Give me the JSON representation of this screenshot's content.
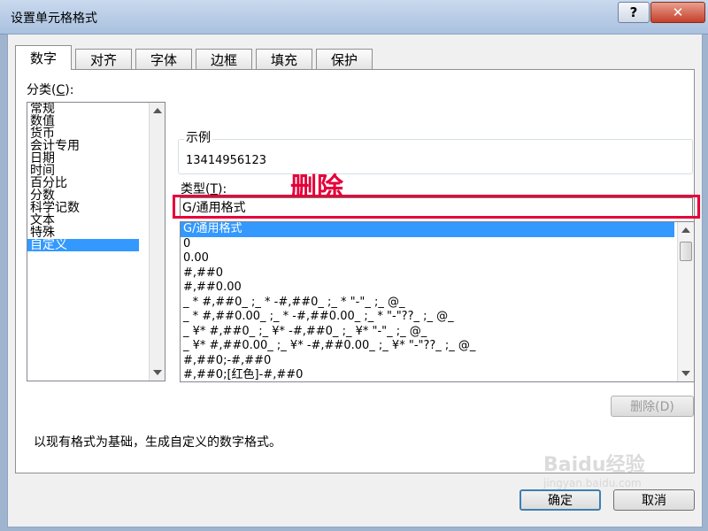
{
  "window": {
    "title": "设置单元格格式",
    "help_label": "?",
    "close_label": "✕"
  },
  "tabs": [
    {
      "label": "数字",
      "active": true
    },
    {
      "label": "对齐"
    },
    {
      "label": "字体"
    },
    {
      "label": "边框"
    },
    {
      "label": "填充"
    },
    {
      "label": "保护"
    }
  ],
  "category": {
    "label": "分类(",
    "key": "C",
    "label_end": "):",
    "items": [
      "常规",
      "数值",
      "货币",
      "会计专用",
      "日期",
      "时间",
      "百分比",
      "分数",
      "科学记数",
      "文本",
      "特殊",
      "自定义"
    ],
    "selected": "自定义"
  },
  "sample": {
    "legend": "示例",
    "value": "13414956123"
  },
  "type": {
    "label": "类型(",
    "key": "T",
    "label_end": "):",
    "value": "G/通用格式"
  },
  "annotation": "删除",
  "formats": [
    "G/通用格式",
    "0",
    "0.00",
    "#,##0",
    "#,##0.00",
    "_ * #,##0_ ;_ * -#,##0_ ;_ * \"-\"_ ;_ @_",
    "_ * #,##0.00_ ;_ * -#,##0.00_ ;_ * \"-\"??_ ;_ @_",
    "_ ¥* #,##0_ ;_ ¥* -#,##0_ ;_ ¥* \"-\"_ ;_ @_",
    "_ ¥* #,##0.00_ ;_ ¥* -#,##0.00_ ;_ ¥* \"-\"??_ ;_ @_",
    "#,##0;-#,##0",
    "#,##0;[红色]-#,##0"
  ],
  "buttons": {
    "delete": "删除(D)",
    "ok": "确定",
    "cancel": "取消"
  },
  "description": "以现有格式为基础，生成自定义的数字格式。",
  "watermark": {
    "logo": "Baidu经验",
    "url": "jingyan.baidu.com"
  }
}
